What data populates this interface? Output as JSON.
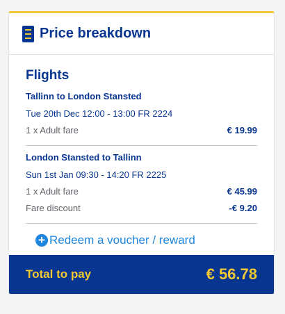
{
  "header": {
    "title": "Price breakdown",
    "icon": "receipt-icon"
  },
  "flights": {
    "section_title": "Flights",
    "legs": [
      {
        "route": "Tallinn to London Stansted",
        "datetime": "Tue 20th Dec 12:00 - 13:00 FR 2224",
        "fares": [
          {
            "label": "1 x Adult fare",
            "price": "€ 19.99"
          }
        ]
      },
      {
        "route": "London Stansted to Tallinn",
        "datetime": "Sun 1st Jan 09:30 - 14:20 FR 2225",
        "fares": [
          {
            "label": "1 x Adult fare",
            "price": "€ 45.99"
          },
          {
            "label": "Fare discount",
            "price": "-€ 9.20"
          }
        ]
      }
    ]
  },
  "voucher": {
    "label": "Redeem a voucher / reward",
    "icon": "plus-circle-icon"
  },
  "total": {
    "label": "Total to pay",
    "amount": "€ 56.78"
  },
  "colors": {
    "brand_blue": "#073590",
    "brand_yellow": "#f1c933",
    "link_blue": "#1e86dd",
    "muted_text": "#5f6368"
  }
}
